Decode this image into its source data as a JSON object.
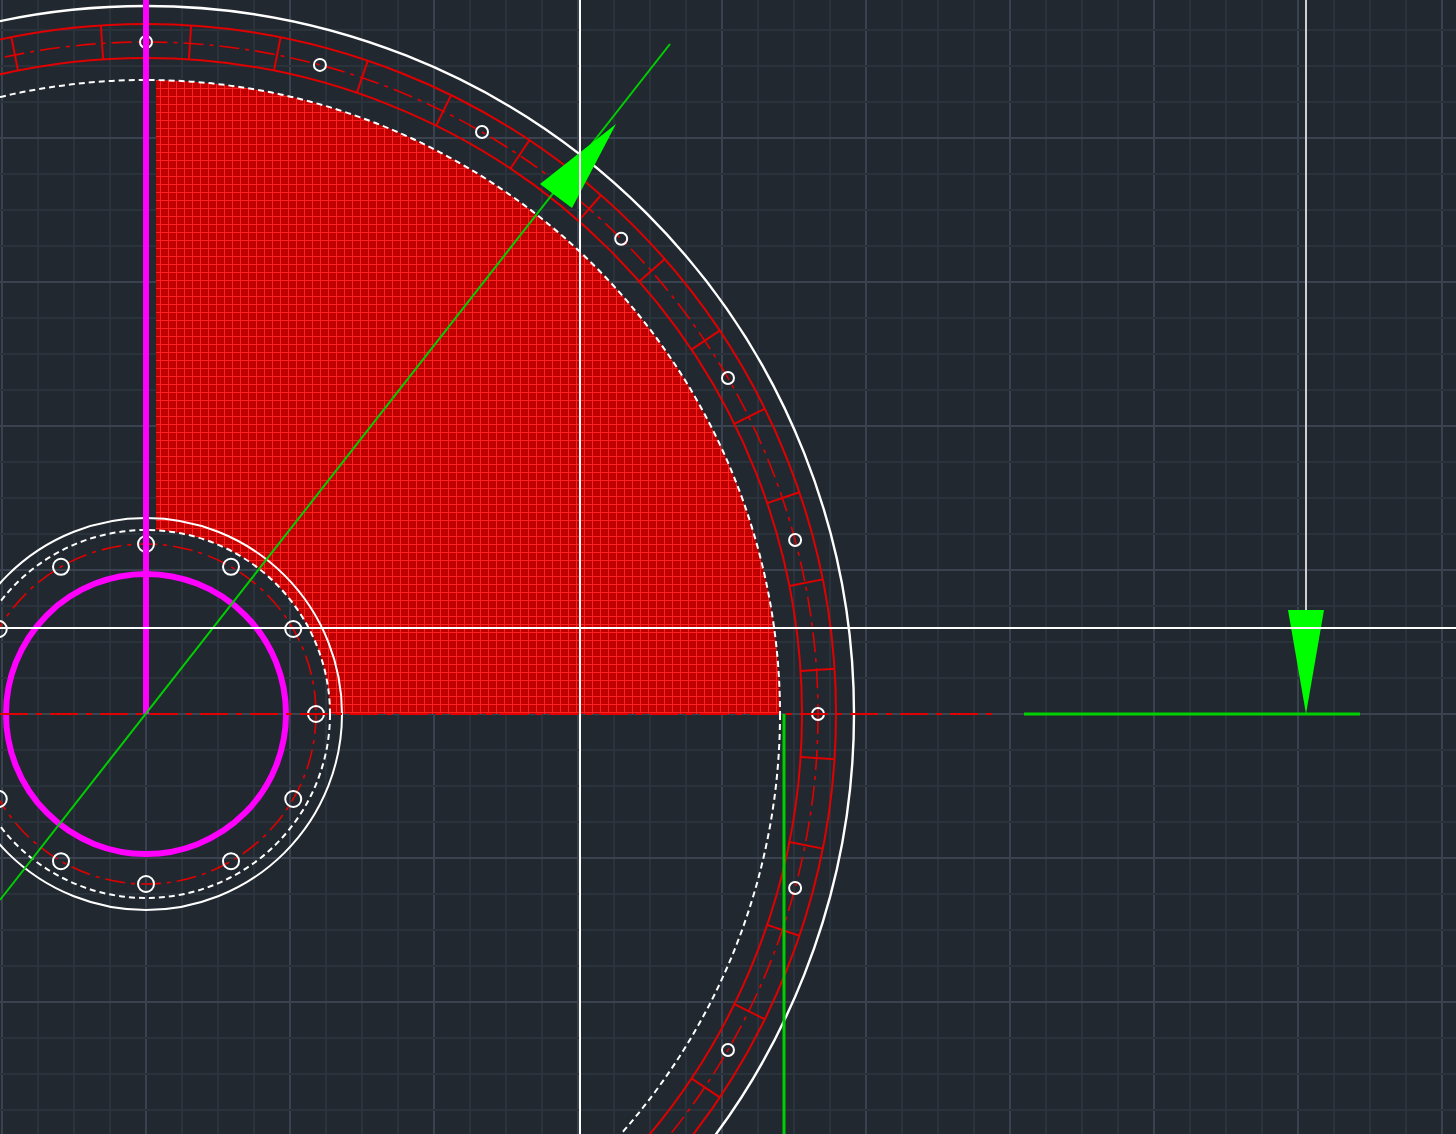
{
  "canvas": {
    "crosshair": true
  }
}
